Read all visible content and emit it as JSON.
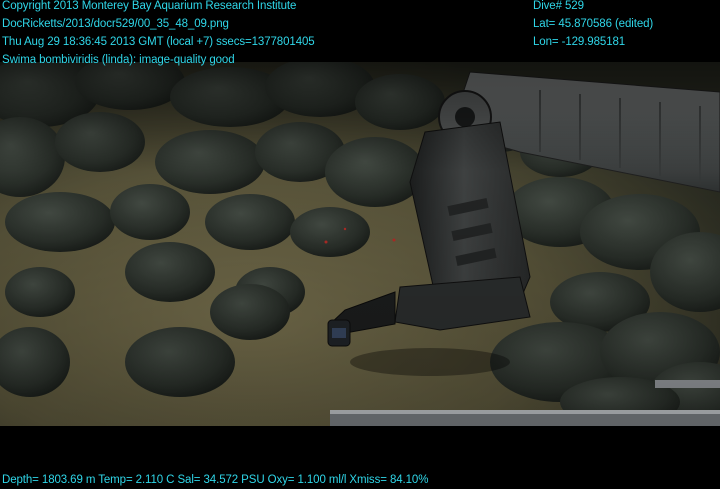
{
  "overlay": {
    "top_left": [
      "Copyright 2013 Monterey Bay Aquarium Research Institute",
      "DocRicketts/2013/docr529/00_35_48_09.png",
      "Thu Aug 29 18:36:45 2013 GMT (local +7)  ssecs=1377801405",
      "Swima bombiviridis (linda): image-quality good"
    ],
    "top_right": [
      "Dive# 529",
      "Lat= 45.870586 (edited)",
      "Lon= -129.985181"
    ],
    "bottom": "Depth= 1803.69 m  Temp= 2.110 C  Sal= 34.572 PSU  Oxy= 1.100 ml/l  Xmiss= 84.10%"
  },
  "colors": {
    "overlay_text": "#2fd6e8",
    "background": "#000000",
    "sediment": "#6f6848",
    "basalt": "#2f3530"
  },
  "scene": {
    "subject": "ROV manipulator arm over pillow basalt seafloor"
  }
}
